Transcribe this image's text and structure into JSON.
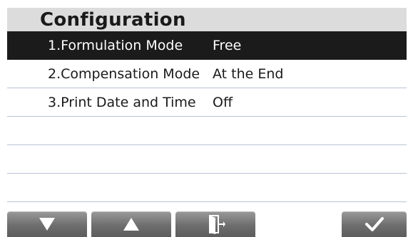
{
  "header": {
    "title": "Configuration"
  },
  "menu": {
    "items": [
      {
        "label": "1.Formulation Mode",
        "value": "Free",
        "selected": true
      },
      {
        "label": "2.Compensation Mode",
        "value": "At the End",
        "selected": false
      },
      {
        "label": "3.Print Date and Time",
        "value": "Off",
        "selected": false
      },
      {
        "label": "",
        "value": "",
        "selected": false
      },
      {
        "label": "",
        "value": "",
        "selected": false
      },
      {
        "label": "",
        "value": "",
        "selected": false
      }
    ]
  },
  "softkeys": [
    {
      "icon": "down-arrow-icon"
    },
    {
      "icon": "up-arrow-icon"
    },
    {
      "icon": "exit-door-icon"
    },
    {
      "icon": "checkmark-icon"
    }
  ],
  "colors": {
    "selected_row_bg": "#1b1b1b",
    "header_bg": "#dcdcdc",
    "divider": "#b8c3d6",
    "softkey_bg": "#6e6e6e"
  }
}
